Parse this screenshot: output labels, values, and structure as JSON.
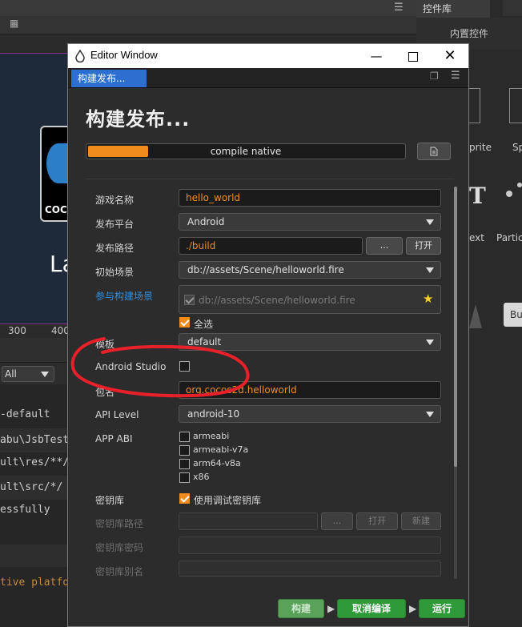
{
  "background": {
    "ruler_labels": [
      "300",
      "400"
    ],
    "console_filter": "All",
    "console_lines": [
      "-default",
      "abu\\JsbTest",
      "ult\\res/**/",
      "ult\\src/*/",
      "essfully",
      "tive platfo"
    ],
    "right_panel": {
      "tab": "控件库",
      "subtitle": "内置控件",
      "items": [
        "prite",
        "Sp",
        "ext",
        "Partic",
        "Bu"
      ]
    },
    "logo_text": "COCO",
    "scene_text": "La"
  },
  "window": {
    "title": "Editor Window",
    "tab": "构建发布...",
    "panel_title": "构建发布...",
    "progress": {
      "text": "compile native",
      "percent": 19
    },
    "fields": {
      "game_name": {
        "label": "游戏名称",
        "value": "hello_world"
      },
      "platform": {
        "label": "发布平台",
        "value": "Android"
      },
      "build_path": {
        "label": "发布路径",
        "value": "./build",
        "browse": "...",
        "open": "打开"
      },
      "start_scene": {
        "label": "初始场景",
        "value": "db://assets/Scene/helloworld.fire"
      },
      "build_scenes": {
        "label": "参与构建场景",
        "item": "db://assets/Scene/helloworld.fire",
        "select_all": "全选"
      },
      "template": {
        "label": "模板",
        "value": "default"
      },
      "android_studio": {
        "label": "Android Studio",
        "checked": false
      },
      "package_name": {
        "label": "包名",
        "value": "org.cocos2d.helloworld"
      },
      "api_level": {
        "label": "API Level",
        "value": "android-10"
      },
      "app_abi": {
        "label": "APP ABI",
        "options": [
          "armeabi",
          "armeabi-v7a",
          "arm64-v8a",
          "x86"
        ]
      },
      "keystore": {
        "label": "密钥库",
        "use_debug": "使用调试密钥库"
      },
      "keystore_path": {
        "label": "密钥库路径",
        "browse": "...",
        "open": "打开",
        "new": "新建"
      },
      "keystore_password": {
        "label": "密钥库密码"
      },
      "keystore_alias": {
        "label": "密钥库别名"
      }
    },
    "footer": {
      "build": "构建",
      "compile_cancel": "取消编译",
      "run": "运行"
    }
  },
  "colors": {
    "accent": "#f08c1e",
    "tab_blue": "#2c6fd1",
    "link_blue": "#2e8fe0",
    "green": "#2f9a3a",
    "annotation_red": "#e8202a"
  }
}
